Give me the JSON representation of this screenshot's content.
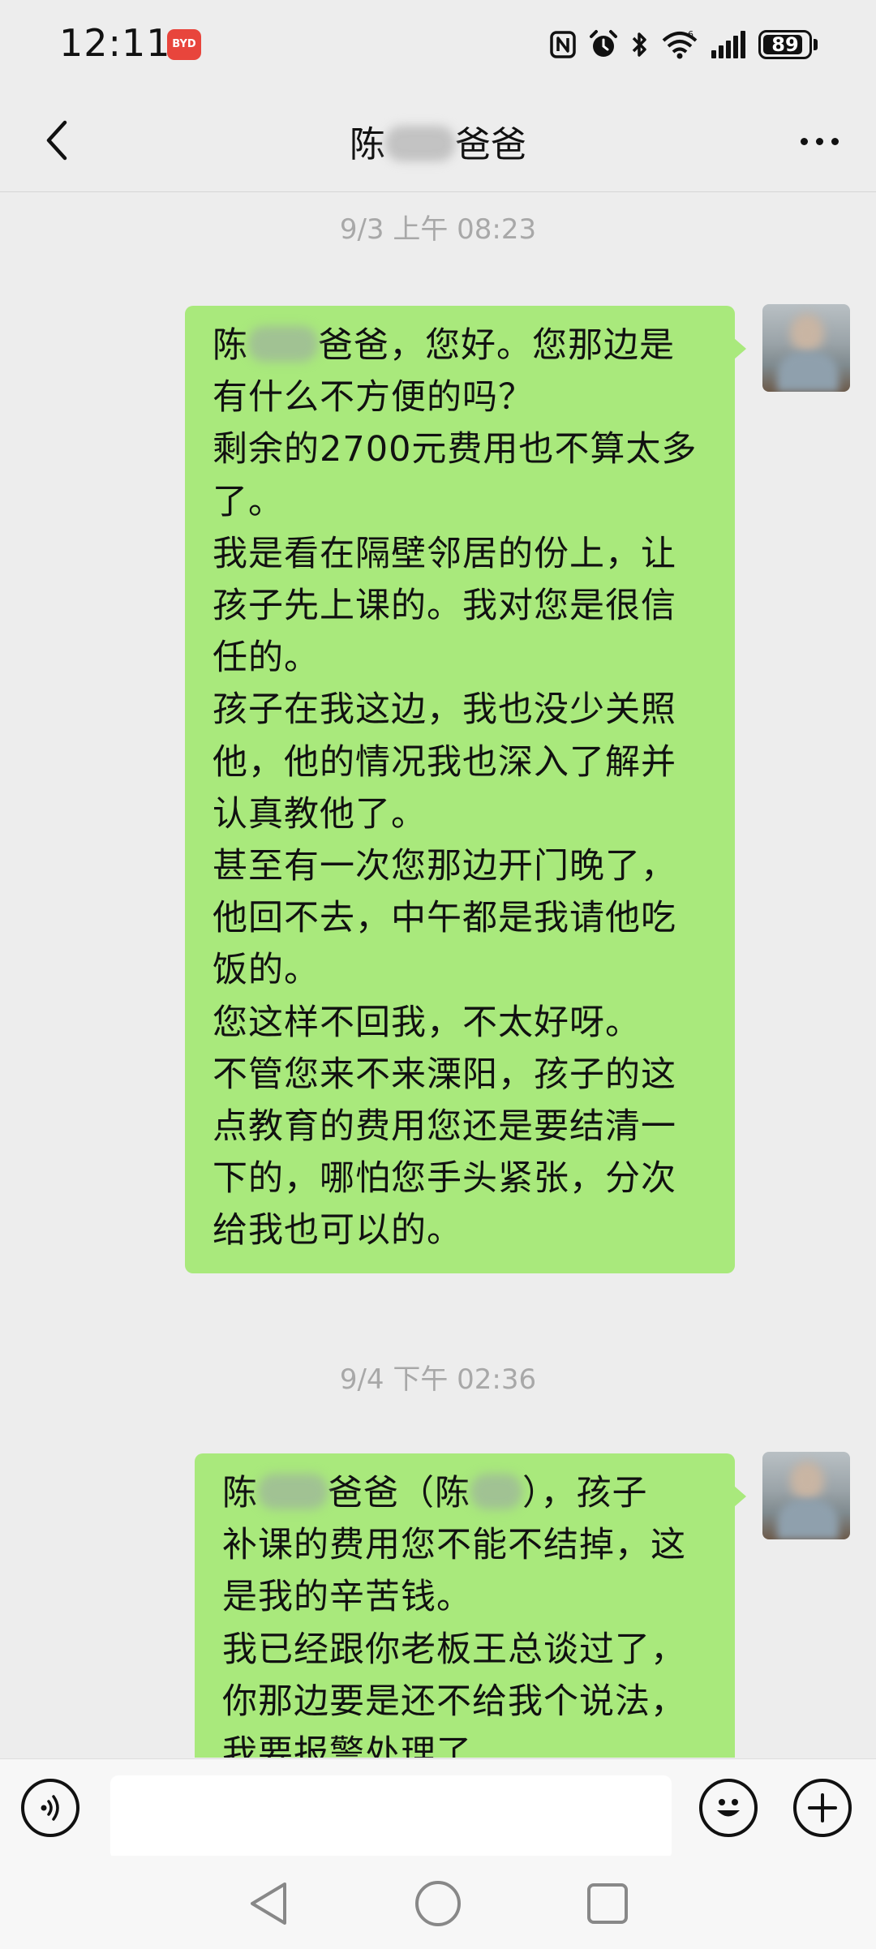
{
  "status_bar": {
    "time": "12:11",
    "app_icon_label": "BYD",
    "battery_level": 89,
    "battery_text": "89"
  },
  "nav": {
    "title_prefix": "陈",
    "title_suffix": "爸爸"
  },
  "messages": [
    {
      "timestamp": "9/3 上午 08:23",
      "lines": [
        {
          "before": "陈",
          "after": "爸爸，您好。您那边是",
          "has_blur": true
        },
        {
          "text": "有什么不方便的吗？"
        },
        {
          "text": "剩余的2700元费用也不算太多"
        },
        {
          "text": "了。"
        },
        {
          "text": "我是看在隔壁邻居的份上，让"
        },
        {
          "text": "孩子先上课的。我对您是很信"
        },
        {
          "text": "任的。"
        },
        {
          "text": "孩子在我这边，我也没少关照"
        },
        {
          "text": "他，他的情况我也深入了解并"
        },
        {
          "text": "认真教他了。"
        },
        {
          "text": "甚至有一次您那边开门晚了，"
        },
        {
          "text": "他回不去，中午都是我请他吃"
        },
        {
          "text": "饭的。"
        },
        {
          "text": "您这样不回我，不太好呀。"
        },
        {
          "text": "不管您来不来溧阳，孩子的这"
        },
        {
          "text": "点教育的费用您还是要结清一"
        },
        {
          "text": "下的，哪怕您手头紧张，分次"
        },
        {
          "text": "给我也可以的。"
        }
      ]
    },
    {
      "timestamp": "9/4 下午 02:36",
      "lines": [
        {
          "before": "陈",
          "mid": "爸爸（陈",
          "after": "），孩子",
          "has_blur": true
        },
        {
          "text": "补课的费用您不能不结掉，这"
        },
        {
          "text": "是我的辛苦钱。"
        },
        {
          "text": "我已经跟你老板王总谈过了，"
        },
        {
          "text": "你那边要是还不给我个说法，"
        },
        {
          "text": "我要报警处理了"
        }
      ]
    }
  ],
  "icons": {
    "back": "chevron-left-icon",
    "more": "more-dots-icon",
    "voice": "voice-icon",
    "emoji": "emoji-icon",
    "plus": "plus-icon",
    "nfc": "nfc-icon",
    "alarm": "alarm-icon",
    "bluetooth": "bluetooth-icon",
    "wifi": "wifi-icon",
    "signal": "signal-icon"
  },
  "colors": {
    "bubble": "#a9e97c",
    "background": "#ededed",
    "timestamp": "#a8a8a8",
    "brand_icon": "#e8453c"
  }
}
